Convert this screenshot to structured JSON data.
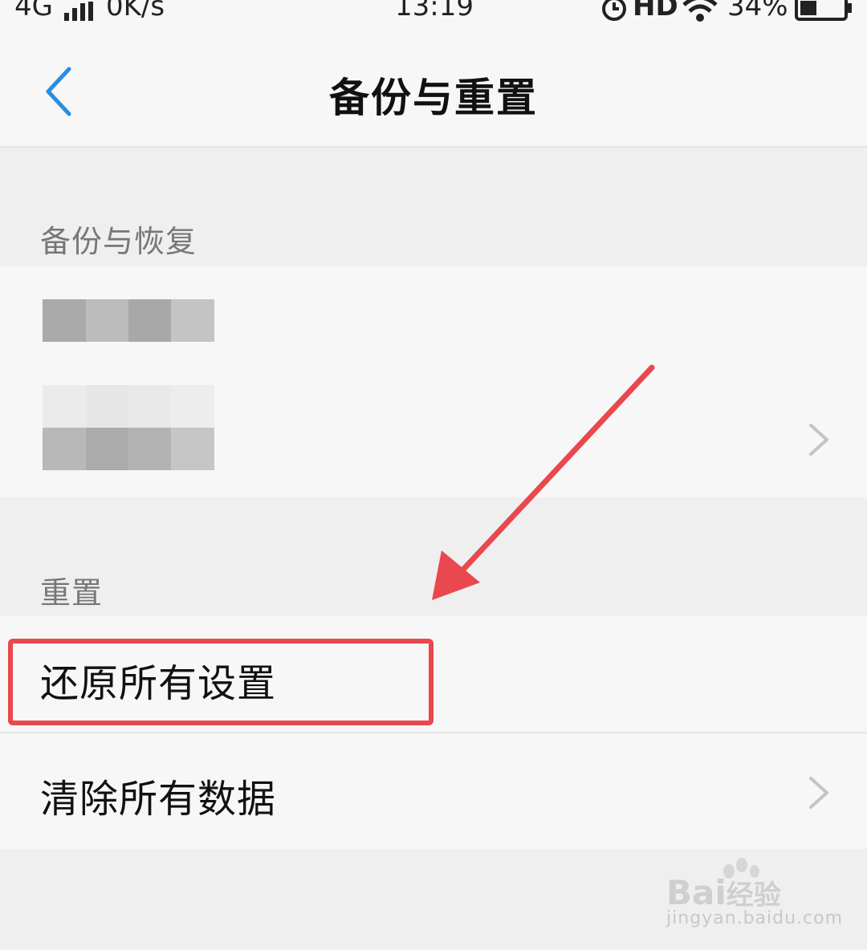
{
  "status_bar": {
    "network": "4G",
    "speed": "0K/s",
    "time": "13:19",
    "hd": "HD",
    "battery": "34%"
  },
  "nav": {
    "title": "备份与重置",
    "back_icon": "chevron-left-icon"
  },
  "sections": [
    {
      "header": "备份与恢复",
      "items": [
        {
          "label": "",
          "blurred": true
        },
        {
          "label": "",
          "blurred": true,
          "chevron": true
        }
      ]
    },
    {
      "header": "重置",
      "items": [
        {
          "label": "还原所有设置",
          "highlighted": true
        },
        {
          "label": "清除所有数据",
          "chevron": true
        }
      ]
    }
  ],
  "watermark": {
    "brand": "Bai",
    "brand_suffix": "经验",
    "url": "jingyan.baidu.com"
  },
  "colors": {
    "accent": "#2a8ee0",
    "annotation": "#e8484e",
    "background": "#efefef",
    "surface": "#f7f7f7"
  }
}
